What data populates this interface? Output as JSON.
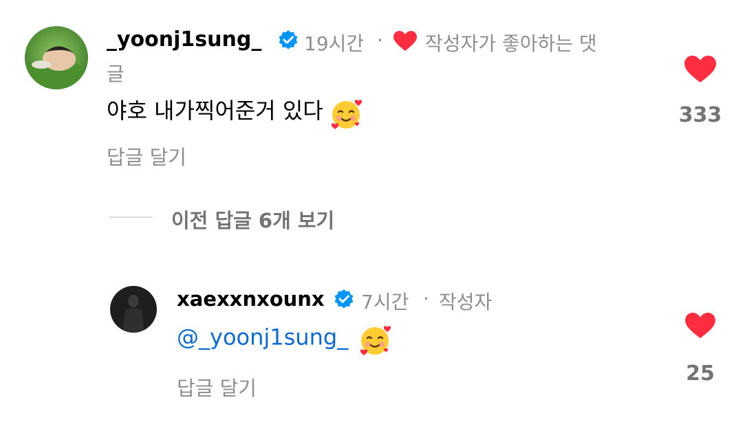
{
  "comments": [
    {
      "username": "_yoonj1sung_",
      "verified": true,
      "time": "19시간",
      "separator": "·",
      "creator_liked_label": "작성자가 좋아하는 댓",
      "creator_liked_label_wrap": "글",
      "text": "야호 내가찍어준거 있다",
      "emoji": "🥰",
      "reply_label": "답글 달기",
      "like_count": "333",
      "like_icon": "heart-icon"
    }
  ],
  "replies_toggle": {
    "label": "이전 답글 6개 보기"
  },
  "reply": {
    "username": "xaexxnxounx",
    "verified": true,
    "time": "7시간",
    "separator": "·",
    "author_badge": "작성자",
    "mention": "@_yoonj1sung_",
    "emoji": "🥰",
    "reply_label": "답글 달기",
    "like_count": "25",
    "like_icon": "heart-icon"
  },
  "colors": {
    "heart": "#ff2d3f",
    "verified": "#0095f6",
    "mention": "#0a6bd6",
    "muted": "#8e8e8e"
  }
}
